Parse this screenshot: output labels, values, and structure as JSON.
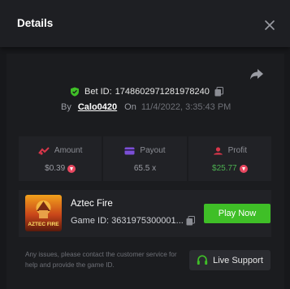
{
  "modal": {
    "title": "Details"
  },
  "bet": {
    "label": "Bet ID:",
    "id": "1748602971281978240",
    "by_label": "By",
    "user": "Calo0420",
    "on_label": "On",
    "date": "11/4/2022, 3:35:43 PM"
  },
  "stats": {
    "amount": {
      "label": "Amount",
      "value": "$0.39"
    },
    "payout": {
      "label": "Payout",
      "value": "65.5 x"
    },
    "profit": {
      "label": "Profit",
      "value": "$25.77"
    }
  },
  "game": {
    "name": "Aztec Fire",
    "id": "Game ID: 3631975300001...",
    "play_label": "Play Now",
    "thumb_text": "AZTEC FIRE"
  },
  "footer": {
    "note": "Any issues, please contact the customer service for help and provide the game ID.",
    "support_label": "Live Support"
  },
  "colors": {
    "accent_green": "#3fbf27",
    "profit_green": "#4caf50",
    "amount_icon": "#d9364a",
    "payout_icon": "#7b4fd6",
    "profit_icon": "#d9364a",
    "coin": "#e8475f"
  }
}
